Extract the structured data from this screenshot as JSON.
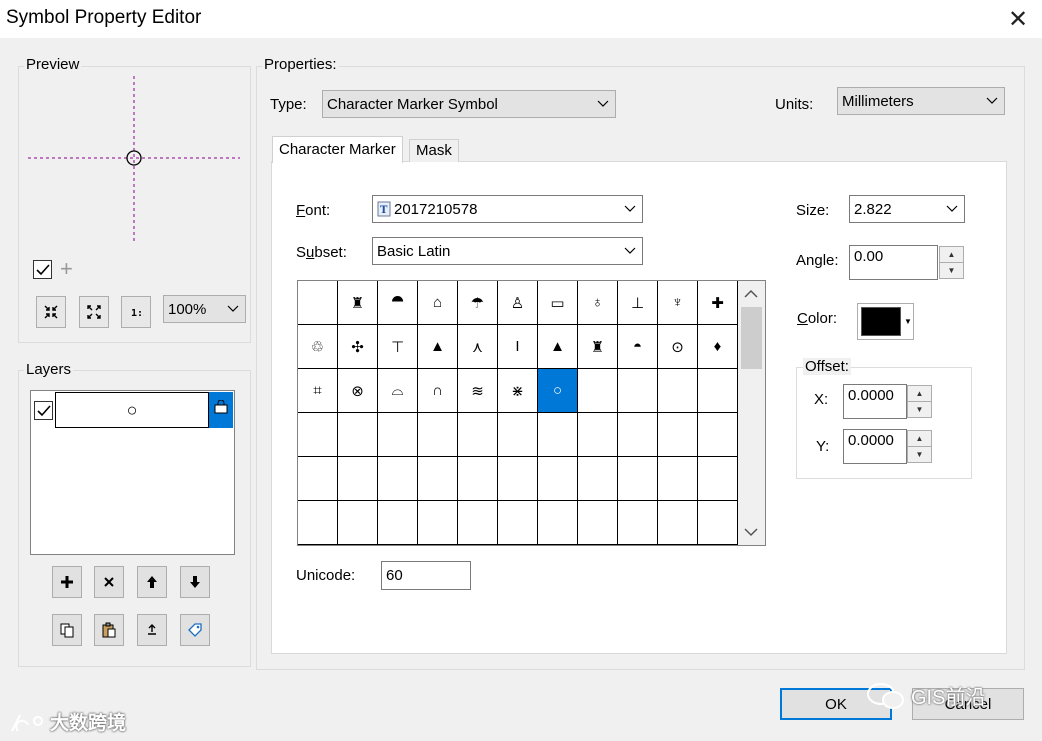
{
  "window": {
    "title": "Symbol Property Editor",
    "close_glyph": "✕"
  },
  "preview": {
    "label": "Preview",
    "show_checked": true,
    "zoom": "100%",
    "buttons": [
      "zoom-in-icon",
      "zoom-extent-icon",
      "actual-size-icon"
    ]
  },
  "layers": {
    "label": "Layers",
    "item_glyph": "○",
    "checked": true
  },
  "properties": {
    "label": "Properties:",
    "type_label": "Type:",
    "type_value": "Character Marker Symbol",
    "units_label": "Units:",
    "units_value": "Millimeters"
  },
  "tabs": {
    "character_marker": "Character Marker",
    "mask": "Mask"
  },
  "char": {
    "font_label_u": "F",
    "font_label_rest": "ont:",
    "font_value": "2017210578",
    "subset_label_pre": "S",
    "subset_label_u": "u",
    "subset_label_rest": "bset:",
    "subset_value": "Basic Latin",
    "size_label": "Size:",
    "size_value": "2.822",
    "angle_label": "Angle:",
    "angle_value": "0.00",
    "color_label_u": "C",
    "color_label_rest": "olor:",
    "color_value": "#000000",
    "offset_label": "Offset:",
    "x_label": "X:",
    "x_value": "0.0000",
    "y_label": "Y:",
    "y_value": "0.0000",
    "unicode_label": "Unicode:",
    "unicode_value": "60"
  },
  "symbols": [
    [
      "",
      "♜",
      "⯊",
      "⌂",
      "☂",
      "♙",
      "▭",
      "♁",
      "⊥",
      "♆",
      "✚"
    ],
    [
      "♲",
      "✣",
      "⊤",
      "▲",
      "⋏",
      "Ι",
      "▲",
      "♜",
      "◓",
      "⊙",
      "♦"
    ],
    [
      "⌗",
      "⊗",
      "⌓",
      "∩",
      "≋",
      "⋇",
      "○",
      "",
      "",
      "",
      ""
    ],
    [
      "",
      "",
      "",
      "",
      "",
      "",
      "",
      "",
      "",
      "",
      ""
    ],
    [
      "",
      "",
      "",
      "",
      "",
      "",
      "",
      "",
      "",
      "",
      ""
    ],
    [
      "",
      "",
      "",
      "",
      "",
      "",
      "",
      "",
      "",
      "",
      ""
    ]
  ],
  "selected_cell": [
    2,
    6
  ],
  "footer": {
    "ok": "OK",
    "cancel": "Cancel"
  },
  "watermarks": {
    "left": "大数跨境",
    "right": "GIS前沿"
  }
}
